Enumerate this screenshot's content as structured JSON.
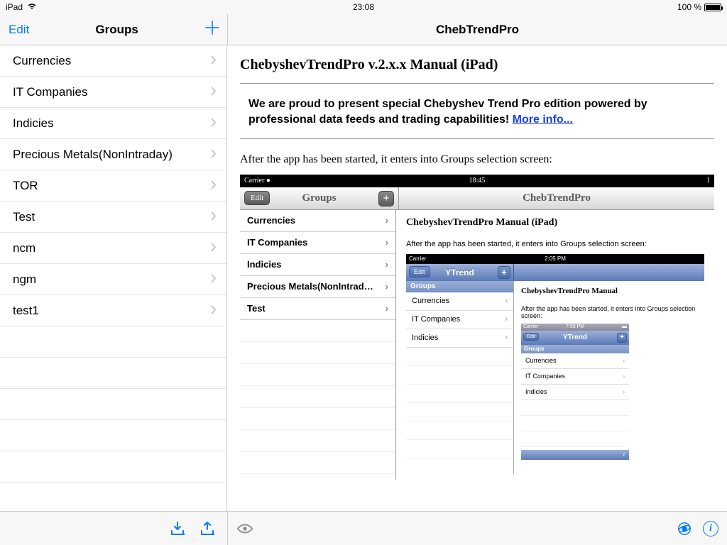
{
  "status": {
    "device": "iPad",
    "time": "23:08",
    "battery": "100 %"
  },
  "master_nav": {
    "edit": "Edit",
    "title": "Groups"
  },
  "detail_nav": {
    "title": "ChebTrendPro"
  },
  "groups": [
    "Currencies",
    "IT Companies",
    "Indicies",
    "Precious Metals(NonIntraday)",
    "TOR",
    "Test",
    "ncm",
    "ngm",
    "test1"
  ],
  "manual": {
    "heading": "ChebyshevTrendPro v.2.x.x Manual (iPad)",
    "promo": "We are proud to present special Chebyshev Trend Pro edition powered by professional data feeds and trading capabilities! ",
    "promo_link": "More info...",
    "after": "After the app has been started, it enters into Groups selection screen:"
  },
  "shot1": {
    "status": {
      "carrier": "Carrier",
      "time": "18:45",
      "right": "1"
    },
    "edit": "Edit",
    "title": "Groups",
    "detail_title": "ChebTrendPro",
    "items": [
      "Currencies",
      "IT Companies",
      "Indicies",
      "Precious Metals(NonIntrad…",
      "Test"
    ],
    "manual_heading": "ChebyshevTrendPro Manual (iPad)",
    "after": "After the app has been started, it enters into Groups selection screen:"
  },
  "shot2": {
    "status": {
      "carrier": "Carrier",
      "time": "2:05 PM"
    },
    "edit": "Edit",
    "title": "YTrend",
    "sub": "Groups",
    "items": [
      "Currencies",
      "IT Companies",
      "Indicies"
    ],
    "manual_heading": "ChebyshevTrendPro Manual",
    "after": "After the app has been started, it enters into Groups selection screen:"
  },
  "shot3": {
    "status": {
      "carrier": "Carrier",
      "time": "7:55 PM"
    },
    "edit": "Edit",
    "title": "YTrend",
    "sub": "Groups",
    "items": [
      "Currencies",
      "IT Companies",
      "Indicies"
    ],
    "foot": "i"
  }
}
